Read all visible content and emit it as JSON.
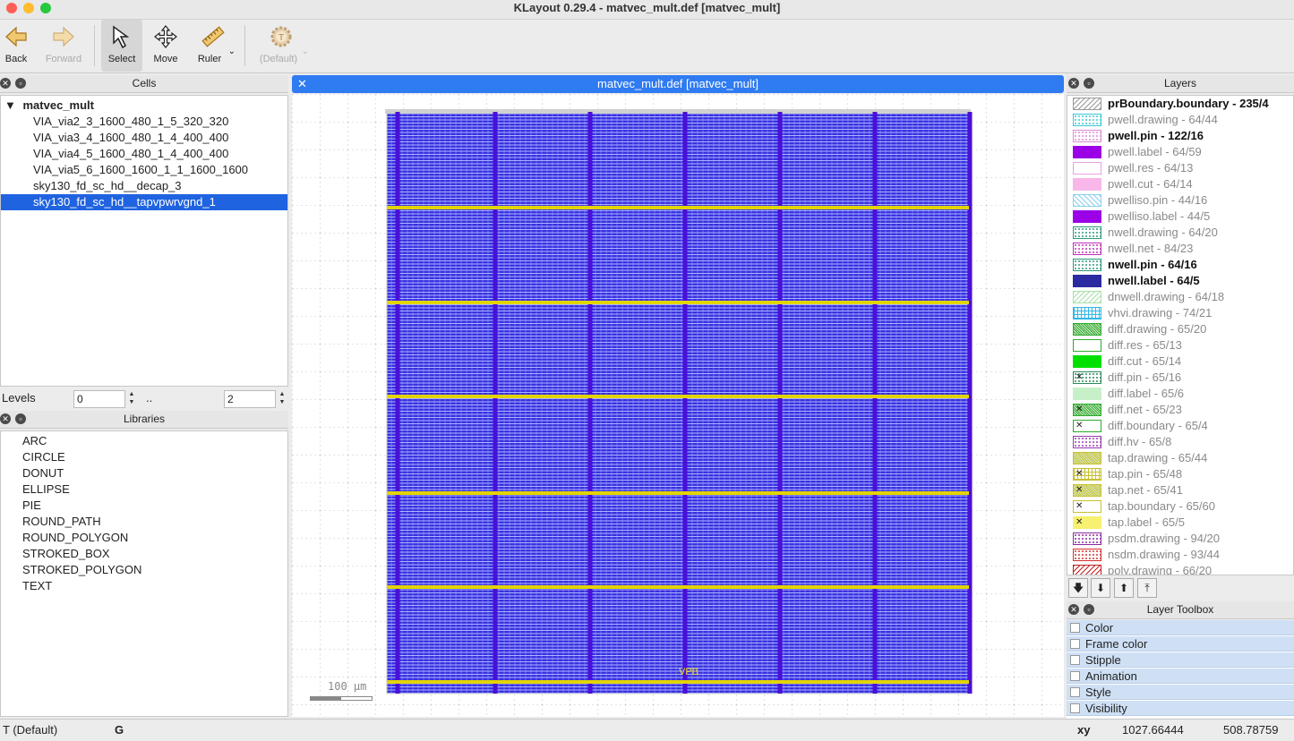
{
  "window": {
    "title": "KLayout 0.29.4 - matvec_mult.def [matvec_mult]"
  },
  "toolbar": {
    "back": "Back",
    "forward": "Forward",
    "select": "Select",
    "move": "Move",
    "ruler": "Ruler",
    "default": "(Default)"
  },
  "cells": {
    "title": "Cells",
    "root": "matvec_mult",
    "items": [
      "VIA_via2_3_1600_480_1_5_320_320",
      "VIA_via3_4_1600_480_1_4_400_400",
      "VIA_via4_5_1600_480_1_4_400_400",
      "VIA_via5_6_1600_1600_1_1_1600_1600",
      "sky130_fd_sc_hd__decap_3",
      "sky130_fd_sc_hd__tapvpwrvgnd_1"
    ],
    "selected_index": 5
  },
  "levels": {
    "label": "Levels",
    "from": "0",
    "sep": "..",
    "to": "2"
  },
  "libraries": {
    "title": "Libraries",
    "items": [
      "ARC",
      "CIRCLE",
      "DONUT",
      "ELLIPSE",
      "PIE",
      "ROUND_PATH",
      "ROUND_POLYGON",
      "STROKED_BOX",
      "STROKED_POLYGON",
      "TEXT"
    ]
  },
  "canvas": {
    "tab_title": "matvec_mult.def [matvec_mult]",
    "scale_label": "100 µm",
    "net_label": "VPB",
    "colors": {
      "fill": "#3a2fe0",
      "hatch": "#a9b6ff",
      "stripe": "#e2d400",
      "vline": "#4a10d8",
      "tab": "#2f7bf2"
    }
  },
  "layers": {
    "title": "Layers",
    "items": [
      {
        "name": "prBoundary.boundary - 235/4",
        "bold": true,
        "style": "hatch",
        "color": "#9a9a9a"
      },
      {
        "name": "pwell.drawing - 64/44",
        "bold": false,
        "style": "dots",
        "color": "#38c8d8"
      },
      {
        "name": "pwell.pin - 122/16",
        "bold": true,
        "style": "dots",
        "color": "#e08ad8"
      },
      {
        "name": "pwell.label - 64/59",
        "bold": false,
        "style": "solid",
        "color": "#9b00e6"
      },
      {
        "name": "pwell.res - 64/13",
        "bold": false,
        "style": "empty",
        "color": "#e6a0e6"
      },
      {
        "name": "pwell.cut - 64/14",
        "bold": false,
        "style": "solid",
        "color": "#f9b6e8"
      },
      {
        "name": "pwelliso.pin - 44/16",
        "bold": false,
        "style": "cross",
        "color": "#8ad0f0"
      },
      {
        "name": "pwelliso.label - 44/5",
        "bold": false,
        "style": "solid",
        "color": "#9b00e6"
      },
      {
        "name": "nwell.drawing - 64/20",
        "bold": false,
        "style": "dots",
        "color": "#2a9a7a"
      },
      {
        "name": "nwell.net - 84/23",
        "bold": false,
        "style": "dots",
        "color": "#c030b8"
      },
      {
        "name": "nwell.pin - 64/16",
        "bold": true,
        "style": "dots",
        "color": "#2a9a7a"
      },
      {
        "name": "nwell.label - 64/5",
        "bold": true,
        "style": "solid",
        "color": "#2b2aa0"
      },
      {
        "name": "dnwell.drawing - 64/18",
        "bold": false,
        "style": "hatch",
        "color": "#a8e0a8"
      },
      {
        "name": "vhvi.drawing - 74/21",
        "bold": false,
        "style": "grid",
        "color": "#30b8e8"
      },
      {
        "name": "diff.drawing - 65/20",
        "bold": false,
        "style": "dense",
        "color": "#2eaa2e"
      },
      {
        "name": "diff.res - 65/13",
        "bold": false,
        "style": "empty",
        "color": "#2eaa2e"
      },
      {
        "name": "diff.cut - 65/14",
        "bold": false,
        "style": "solid",
        "color": "#00e000"
      },
      {
        "name": "diff.pin - 65/16",
        "bold": false,
        "style": "xdots",
        "color": "#2a8a5a"
      },
      {
        "name": "diff.label - 65/6",
        "bold": false,
        "style": "solid",
        "color": "#c8f0c8"
      },
      {
        "name": "diff.net - 65/23",
        "bold": false,
        "style": "xdense",
        "color": "#2eaa2e"
      },
      {
        "name": "diff.boundary - 65/4",
        "bold": false,
        "style": "xempty",
        "color": "#2eaa2e"
      },
      {
        "name": "diff.hv - 65/8",
        "bold": false,
        "style": "dots",
        "color": "#9a3ab0"
      },
      {
        "name": "tap.drawing - 65/44",
        "bold": false,
        "style": "dense",
        "color": "#c8c030"
      },
      {
        "name": "tap.pin - 65/48",
        "bold": false,
        "style": "xgrid",
        "color": "#c8c030"
      },
      {
        "name": "tap.net - 65/41",
        "bold": false,
        "style": "xdense",
        "color": "#c8c030"
      },
      {
        "name": "tap.boundary - 65/60",
        "bold": false,
        "style": "xempty",
        "color": "#c8c030"
      },
      {
        "name": "tap.label - 65/5",
        "bold": false,
        "style": "xsolid",
        "color": "#f8f070"
      },
      {
        "name": "psdm.drawing - 94/20",
        "bold": false,
        "style": "dots",
        "color": "#8a2aa0"
      },
      {
        "name": "nsdm.drawing - 93/44",
        "bold": false,
        "style": "dots",
        "color": "#d83030"
      },
      {
        "name": "poly.drawing - 66/20",
        "bold": false,
        "style": "hatch",
        "color": "#c02020"
      }
    ]
  },
  "layer_toolbox": {
    "title": "Layer Toolbox",
    "items": [
      "Color",
      "Frame color",
      "Stipple",
      "Animation",
      "Style",
      "Visibility"
    ]
  },
  "status": {
    "mode": "T  (Default)",
    "grid": "G",
    "xy_label": "xy",
    "x": "1027.66444",
    "y": "508.78759"
  }
}
